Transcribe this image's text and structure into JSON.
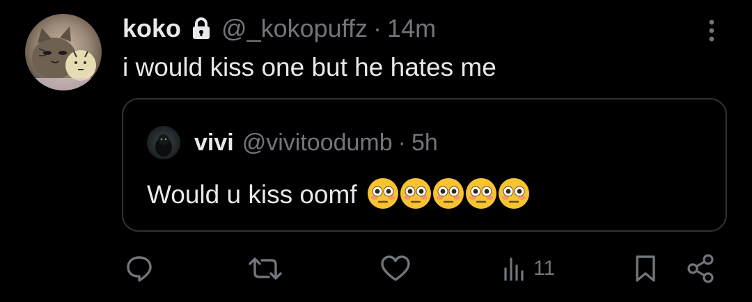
{
  "tweet": {
    "author": {
      "display_name": "koko",
      "handle": "@_kokopuffz",
      "protected_icon": "lock-icon",
      "avatar": "cat-avatar"
    },
    "separator": "·",
    "time": "14m",
    "text": "i would kiss one but he hates me",
    "more_icon": "more-vertical-icon"
  },
  "quote": {
    "author": {
      "display_name": "vivi",
      "handle": "@vivitoodumb",
      "avatar": "dark-avatar"
    },
    "separator": "·",
    "time": "5h",
    "text": "Would u kiss oomf",
    "emojis": [
      "flushed-face",
      "flushed-face",
      "flushed-face",
      "flushed-face",
      "flushed-face"
    ]
  },
  "actions": {
    "reply_icon": "reply-icon",
    "repost_icon": "repost-icon",
    "like_icon": "heart-icon",
    "views_icon": "views-icon",
    "views_count": "11",
    "bookmark_icon": "bookmark-icon",
    "share_icon": "share-icon"
  },
  "colors": {
    "background": "#000000",
    "text_primary": "#e7e9ea",
    "text_secondary": "#71767b",
    "border": "#2f3336",
    "emoji_face": "#f7c331"
  }
}
